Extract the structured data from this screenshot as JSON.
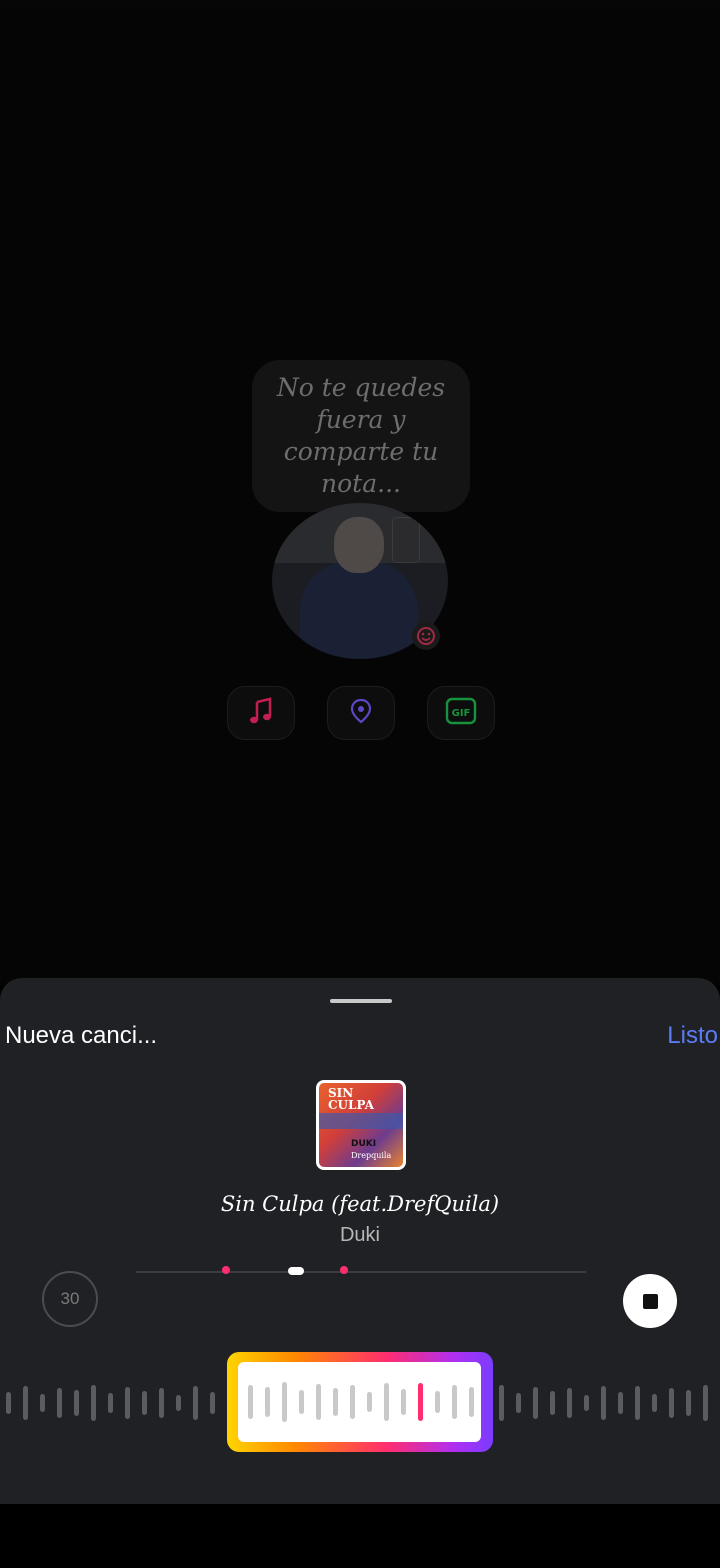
{
  "note": {
    "placeholder": "No te quedes fuera y comparte tu nota..."
  },
  "actions": [
    {
      "icon": "music-note-icon",
      "color": "#e3245e"
    },
    {
      "icon": "location-pin-icon",
      "color": "#6c55e0"
    },
    {
      "label": "GIF",
      "icon": "gif-icon",
      "color": "#1ea848"
    }
  ],
  "sheet": {
    "title": "Nueva canci...",
    "done_label": "Listo"
  },
  "song": {
    "cover_text": "SIN CULPA",
    "cover_artist": "DUKI",
    "cover_feat": "Dreрquila",
    "title": "Sin Culpa (feat.DrefQuila)",
    "artist": "Duki"
  },
  "player": {
    "duration": "30",
    "accent": "#ff2e6e",
    "done_color": "#5b7cf5"
  }
}
